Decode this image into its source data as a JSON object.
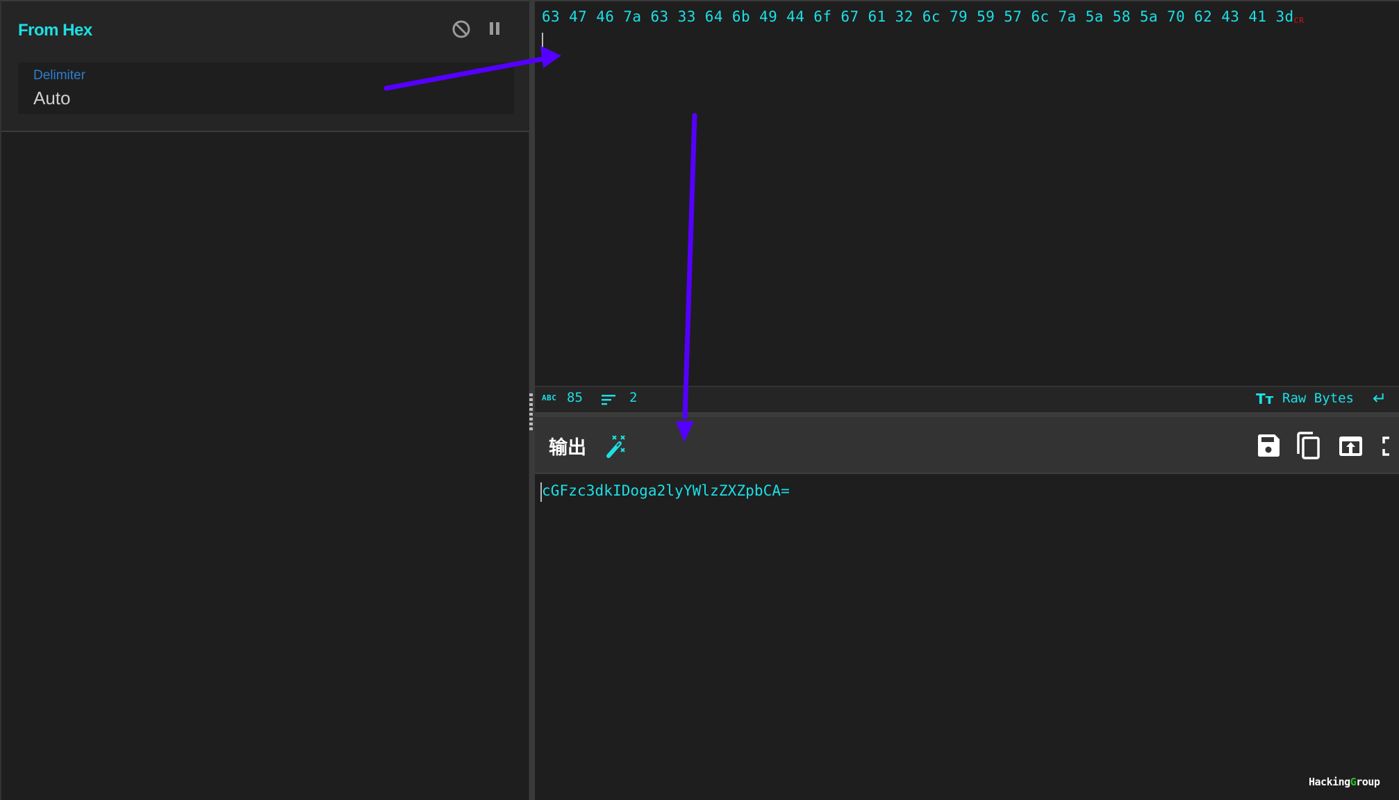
{
  "recipe": {
    "operation": {
      "title": "From Hex",
      "disable_icon": "disable-icon",
      "pause_icon": "pause-icon",
      "args": [
        {
          "label": "Delimiter",
          "value": "Auto"
        }
      ]
    }
  },
  "input": {
    "text": "63 47 46 7a 63 33 64 6b 49 44 6f 67 61 32 6c 79 59 57 6c 7a 5a 58 5a 70 62 43 41 3d",
    "line_ending_marker": "CR",
    "status": {
      "abc_icon_text": "ABC",
      "char_count": "85",
      "line_count": "2",
      "encoding_icon_text": "Tт",
      "encoding": "Raw Bytes",
      "eol_icon": "↵"
    }
  },
  "output": {
    "title": "输出",
    "text": "cGFzc3dkIDoga2lyYWlzZXZpbCA=",
    "buttons": [
      "magic-wand",
      "save",
      "copy",
      "replace-input",
      "maximise"
    ]
  },
  "watermark": {
    "part1": "Hacking",
    "part2": "G",
    "part3": "roup"
  },
  "colors": {
    "accent": "#1ce0e6",
    "argument_label": "#2e7fd0",
    "annotation_arrow": "#5500ff",
    "cr_marker": "#e01010"
  }
}
